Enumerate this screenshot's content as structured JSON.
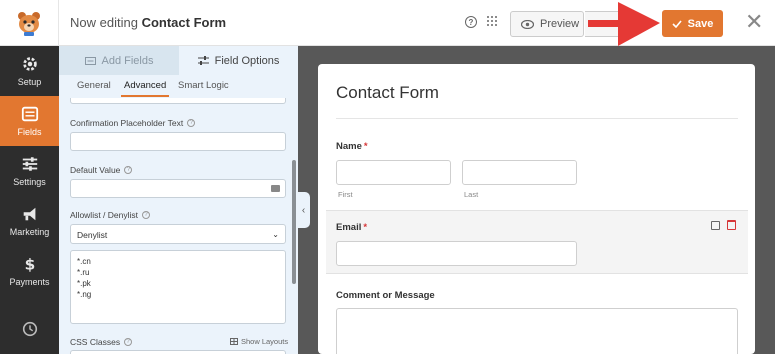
{
  "header": {
    "editing_prefix": "Now editing",
    "form_name": "Contact Form",
    "preview_label": "Preview",
    "save_label": "Save"
  },
  "rail": {
    "items": [
      {
        "label": "Setup",
        "icon": "gear-icon"
      },
      {
        "label": "Fields",
        "icon": "fields-icon"
      },
      {
        "label": "Settings",
        "icon": "sliders-icon"
      },
      {
        "label": "Marketing",
        "icon": "megaphone-icon"
      },
      {
        "label": "Payments",
        "icon": "dollar-icon"
      }
    ],
    "bottom_icon": "history-icon"
  },
  "panel": {
    "tabs": {
      "add_fields": "Add Fields",
      "field_options": "Field Options"
    },
    "subtabs": {
      "general": "General",
      "advanced": "Advanced",
      "smart_logic": "Smart Logic"
    },
    "confirmation_placeholder_label": "Confirmation Placeholder Text",
    "default_value_label": "Default Value",
    "allowlist_label": "Allowlist / Denylist",
    "allowlist_selected": "Denylist",
    "deny_entries": [
      "*.cn",
      "*.ru",
      "*.pk",
      "*.ng"
    ],
    "css_classes_label": "CSS Classes",
    "show_layouts_label": "Show Layouts"
  },
  "form": {
    "title": "Contact Form",
    "name_label": "Name",
    "first_sub": "First",
    "last_sub": "Last",
    "email_label": "Email",
    "comment_label": "Comment or Message",
    "required_mark": "*"
  },
  "colors": {
    "accent": "#e27730",
    "rail_bg": "#2d2d2d",
    "panel_bg": "#ebf3fb",
    "required": "#d63638"
  }
}
